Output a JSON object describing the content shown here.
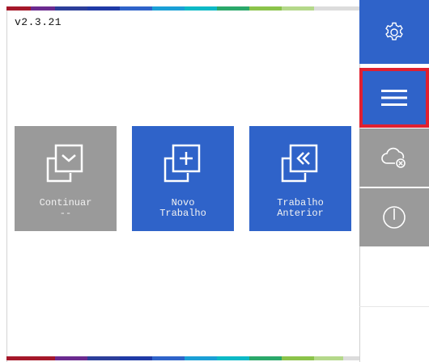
{
  "app": {
    "version": "v2.3.21"
  },
  "tiles": [
    {
      "line1": "Continuar",
      "line2": "--",
      "icon": "copy-chevron-down-icon",
      "color": "#9a9a9a"
    },
    {
      "line1": "Novo",
      "line2": "Trabalho",
      "icon": "copy-plus-icon",
      "color": "#2f63c9"
    },
    {
      "line1": "Trabalho",
      "line2": "Anterior",
      "icon": "copy-double-chevron-left-icon",
      "color": "#2f63c9"
    }
  ],
  "sidebar": {
    "buttons": [
      {
        "icon": "gear-icon",
        "color": "#2f63c9"
      },
      {
        "icon": "hamburger-menu-icon",
        "color": "#2f63c9",
        "highlight": "#e0202f"
      },
      {
        "icon": "cloud-disconnected-icon",
        "color": "#9a9a9a"
      },
      {
        "icon": "power-icon",
        "color": "#9a9a9a"
      }
    ]
  },
  "colors": {
    "accent_blue": "#2f63c9",
    "inactive_gray": "#9a9a9a",
    "highlight_red": "#e0202f"
  }
}
